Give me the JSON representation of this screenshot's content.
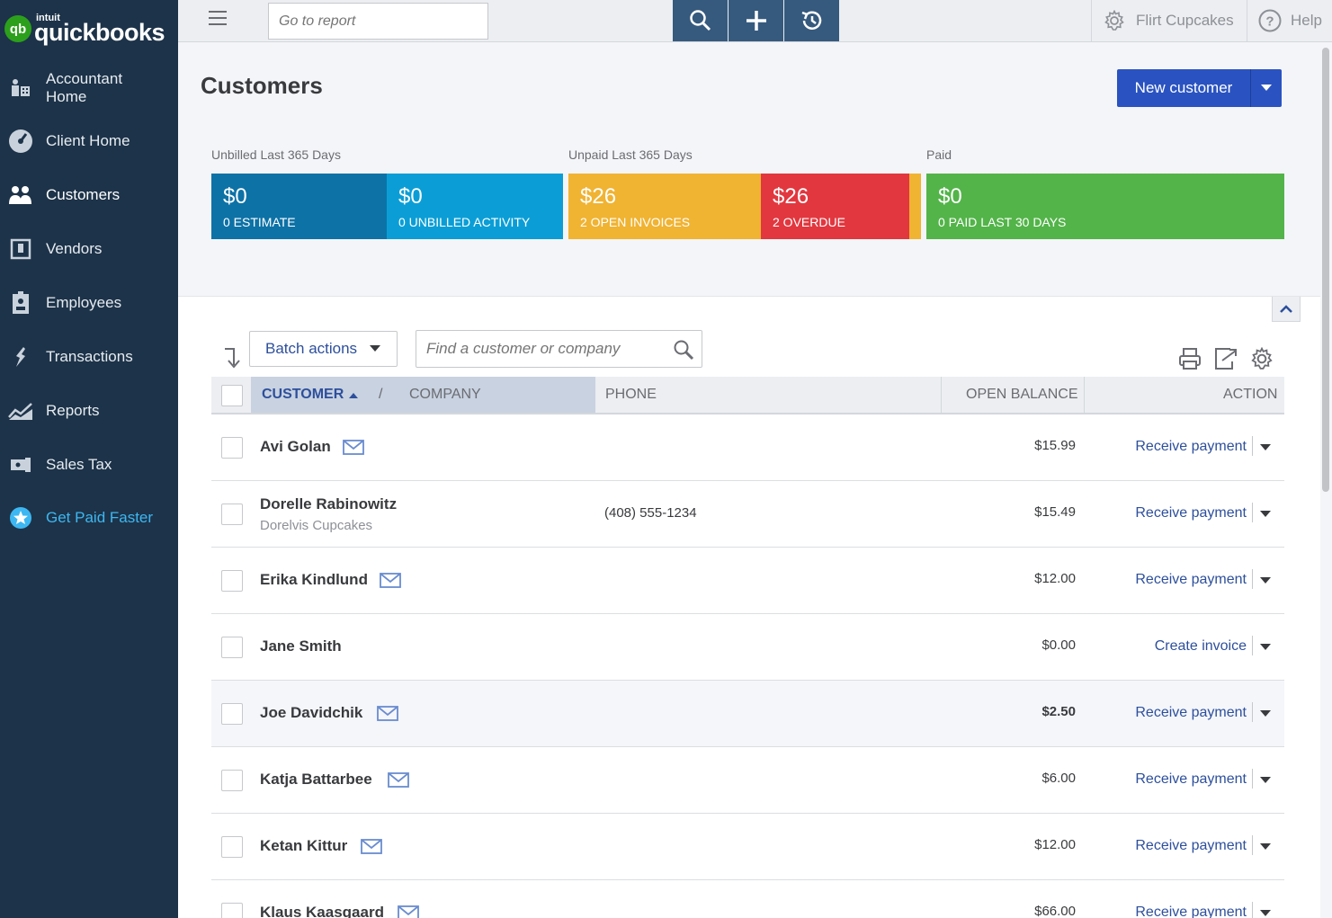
{
  "brand": {
    "intuit": "intuit",
    "name": "quickbooks",
    "mark": "qb"
  },
  "sidebar": {
    "items": [
      {
        "label_line1": "Accountant",
        "label_line2": "Home",
        "icon": "accountant-home-icon"
      },
      {
        "label": "Client Home",
        "icon": "gauge-icon"
      },
      {
        "label": "Customers",
        "icon": "people-icon"
      },
      {
        "label": "Vendors",
        "icon": "vendor-icon"
      },
      {
        "label": "Employees",
        "icon": "badge-icon"
      },
      {
        "label": "Transactions",
        "icon": "transactions-icon"
      },
      {
        "label": "Reports",
        "icon": "chart-icon"
      },
      {
        "label": "Sales Tax",
        "icon": "tag-icon"
      },
      {
        "label": "Get Paid Faster",
        "icon": "star-icon"
      }
    ]
  },
  "topbar": {
    "search_placeholder": "Go to report",
    "company": "Flirt Cupcakes",
    "help": "Help"
  },
  "page": {
    "title": "Customers",
    "new_button": "New customer"
  },
  "stats": {
    "unbilled_caption": "Unbilled Last 365 Days",
    "unpaid_caption": "Unpaid Last 365 Days",
    "paid_caption": "Paid",
    "blocks": [
      {
        "amount": "$0",
        "label": "0 ESTIMATE",
        "color": "#0d72a6"
      },
      {
        "amount": "$0",
        "label": "0 UNBILLED ACTIVITY",
        "color": "#0b9ed6"
      },
      {
        "amount": "$26",
        "label": "2 OPEN INVOICES",
        "color": "#f0b332"
      },
      {
        "amount": "$26",
        "label": "2 OVERDUE",
        "color": "#e2373f"
      },
      {
        "amount": "$0",
        "label": "0 PAID LAST 30 DAYS",
        "color": "#53b449"
      }
    ]
  },
  "table": {
    "batch_label": "Batch actions",
    "find_placeholder": "Find a customer or company",
    "headers": {
      "customer": "CUSTOMER",
      "slash": "/",
      "company": "COMPANY",
      "phone": "PHONE",
      "balance": "OPEN BALANCE",
      "action": "ACTION"
    },
    "rows": [
      {
        "name": "Avi Golan",
        "company": "",
        "phone": "",
        "balance": "$15.99",
        "action": "Receive payment",
        "email": true
      },
      {
        "name": "Dorelle Rabinowitz",
        "company": "Dorelvis Cupcakes",
        "phone": "(408) 555-1234",
        "balance": "$15.49",
        "action": "Receive payment",
        "email": false
      },
      {
        "name": "Erika Kindlund",
        "company": "",
        "phone": "",
        "balance": "$12.00",
        "action": "Receive payment",
        "email": true
      },
      {
        "name": "Jane Smith",
        "company": "",
        "phone": "",
        "balance": "$0.00",
        "action": "Create invoice",
        "email": false
      },
      {
        "name": "Joe Davidchik",
        "company": "",
        "phone": "",
        "balance": "$2.50",
        "action": "Receive payment",
        "email": true
      },
      {
        "name": "Katja Battarbee",
        "company": "",
        "phone": "",
        "balance": "$6.00",
        "action": "Receive payment",
        "email": true
      },
      {
        "name": "Ketan Kittur",
        "company": "",
        "phone": "",
        "balance": "$12.00",
        "action": "Receive payment",
        "email": true
      },
      {
        "name": "Klaus Kaasgaard",
        "company": "",
        "phone": "",
        "balance": "$66.00",
        "action": "Receive payment",
        "email": true
      }
    ]
  }
}
